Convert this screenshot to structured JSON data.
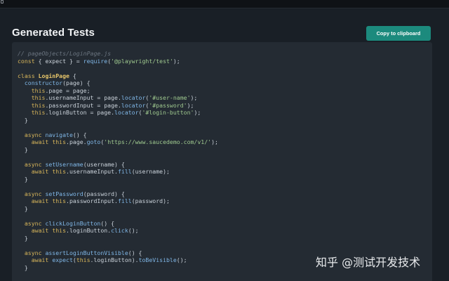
{
  "window": {
    "tab_marker_icon": "tab-icon"
  },
  "header": {
    "title": "Generated Tests",
    "copy_button_label": "Copy to clipboard",
    "accent_color": "#1c8a7d"
  },
  "code": {
    "language": "javascript",
    "lines": [
      [
        {
          "t": "comment",
          "v": "// pageObjects/LoginPage.js"
        }
      ],
      [
        {
          "t": "keyword",
          "v": "const"
        },
        {
          "t": "plain",
          "v": " { expect } = "
        },
        {
          "t": "func",
          "v": "require"
        },
        {
          "t": "plain",
          "v": "("
        },
        {
          "t": "string",
          "v": "'@playwright/test'"
        },
        {
          "t": "plain",
          "v": ");"
        }
      ],
      [],
      [
        {
          "t": "keyword",
          "v": "class"
        },
        {
          "t": "plain",
          "v": " "
        },
        {
          "t": "class",
          "v": "LoginPage"
        },
        {
          "t": "plain",
          "v": " {"
        }
      ],
      [
        {
          "t": "plain",
          "v": "  "
        },
        {
          "t": "func",
          "v": "constructor"
        },
        {
          "t": "plain",
          "v": "(page) {"
        }
      ],
      [
        {
          "t": "plain",
          "v": "    "
        },
        {
          "t": "this",
          "v": "this"
        },
        {
          "t": "plain",
          "v": ".page = page;"
        }
      ],
      [
        {
          "t": "plain",
          "v": "    "
        },
        {
          "t": "this",
          "v": "this"
        },
        {
          "t": "plain",
          "v": ".usernameInput = page."
        },
        {
          "t": "func",
          "v": "locator"
        },
        {
          "t": "plain",
          "v": "("
        },
        {
          "t": "string",
          "v": "'#user-name'"
        },
        {
          "t": "plain",
          "v": ");"
        }
      ],
      [
        {
          "t": "plain",
          "v": "    "
        },
        {
          "t": "this",
          "v": "this"
        },
        {
          "t": "plain",
          "v": ".passwordInput = page."
        },
        {
          "t": "func",
          "v": "locator"
        },
        {
          "t": "plain",
          "v": "("
        },
        {
          "t": "string",
          "v": "'#password'"
        },
        {
          "t": "plain",
          "v": ");"
        }
      ],
      [
        {
          "t": "plain",
          "v": "    "
        },
        {
          "t": "this",
          "v": "this"
        },
        {
          "t": "plain",
          "v": ".loginButton = page."
        },
        {
          "t": "func",
          "v": "locator"
        },
        {
          "t": "plain",
          "v": "("
        },
        {
          "t": "string",
          "v": "'#login-button'"
        },
        {
          "t": "plain",
          "v": ");"
        }
      ],
      [
        {
          "t": "plain",
          "v": "  }"
        }
      ],
      [],
      [
        {
          "t": "plain",
          "v": "  "
        },
        {
          "t": "keyword",
          "v": "async"
        },
        {
          "t": "plain",
          "v": " "
        },
        {
          "t": "func",
          "v": "navigate"
        },
        {
          "t": "plain",
          "v": "() {"
        }
      ],
      [
        {
          "t": "plain",
          "v": "    "
        },
        {
          "t": "keyword",
          "v": "await"
        },
        {
          "t": "plain",
          "v": " "
        },
        {
          "t": "this",
          "v": "this"
        },
        {
          "t": "plain",
          "v": ".page."
        },
        {
          "t": "func",
          "v": "goto"
        },
        {
          "t": "plain",
          "v": "("
        },
        {
          "t": "string",
          "v": "'https://www.saucedemo.com/v1/'"
        },
        {
          "t": "plain",
          "v": ");"
        }
      ],
      [
        {
          "t": "plain",
          "v": "  }"
        }
      ],
      [],
      [
        {
          "t": "plain",
          "v": "  "
        },
        {
          "t": "keyword",
          "v": "async"
        },
        {
          "t": "plain",
          "v": " "
        },
        {
          "t": "func",
          "v": "setUsername"
        },
        {
          "t": "plain",
          "v": "(username) {"
        }
      ],
      [
        {
          "t": "plain",
          "v": "    "
        },
        {
          "t": "keyword",
          "v": "await"
        },
        {
          "t": "plain",
          "v": " "
        },
        {
          "t": "this",
          "v": "this"
        },
        {
          "t": "plain",
          "v": ".usernameInput."
        },
        {
          "t": "func",
          "v": "fill"
        },
        {
          "t": "plain",
          "v": "(username);"
        }
      ],
      [
        {
          "t": "plain",
          "v": "  }"
        }
      ],
      [],
      [
        {
          "t": "plain",
          "v": "  "
        },
        {
          "t": "keyword",
          "v": "async"
        },
        {
          "t": "plain",
          "v": " "
        },
        {
          "t": "func",
          "v": "setPassword"
        },
        {
          "t": "plain",
          "v": "(password) {"
        }
      ],
      [
        {
          "t": "plain",
          "v": "    "
        },
        {
          "t": "keyword",
          "v": "await"
        },
        {
          "t": "plain",
          "v": " "
        },
        {
          "t": "this",
          "v": "this"
        },
        {
          "t": "plain",
          "v": ".passwordInput."
        },
        {
          "t": "func",
          "v": "fill"
        },
        {
          "t": "plain",
          "v": "(password);"
        }
      ],
      [
        {
          "t": "plain",
          "v": "  }"
        }
      ],
      [],
      [
        {
          "t": "plain",
          "v": "  "
        },
        {
          "t": "keyword",
          "v": "async"
        },
        {
          "t": "plain",
          "v": " "
        },
        {
          "t": "func",
          "v": "clickLoginButton"
        },
        {
          "t": "plain",
          "v": "() {"
        }
      ],
      [
        {
          "t": "plain",
          "v": "    "
        },
        {
          "t": "keyword",
          "v": "await"
        },
        {
          "t": "plain",
          "v": " "
        },
        {
          "t": "this",
          "v": "this"
        },
        {
          "t": "plain",
          "v": ".loginButton."
        },
        {
          "t": "func",
          "v": "click"
        },
        {
          "t": "plain",
          "v": "();"
        }
      ],
      [
        {
          "t": "plain",
          "v": "  }"
        }
      ],
      [],
      [
        {
          "t": "plain",
          "v": "  "
        },
        {
          "t": "keyword",
          "v": "async"
        },
        {
          "t": "plain",
          "v": " "
        },
        {
          "t": "func",
          "v": "assertLoginButtonVisible"
        },
        {
          "t": "plain",
          "v": "() {"
        }
      ],
      [
        {
          "t": "plain",
          "v": "    "
        },
        {
          "t": "keyword",
          "v": "await"
        },
        {
          "t": "plain",
          "v": " "
        },
        {
          "t": "func",
          "v": "expect"
        },
        {
          "t": "plain",
          "v": "("
        },
        {
          "t": "this",
          "v": "this"
        },
        {
          "t": "plain",
          "v": ".loginButton)."
        },
        {
          "t": "func",
          "v": "toBeVisible"
        },
        {
          "t": "plain",
          "v": "();"
        }
      ],
      [
        {
          "t": "plain",
          "v": "  }"
        }
      ]
    ]
  },
  "watermark": {
    "text": "知乎 @测试开发技术"
  }
}
